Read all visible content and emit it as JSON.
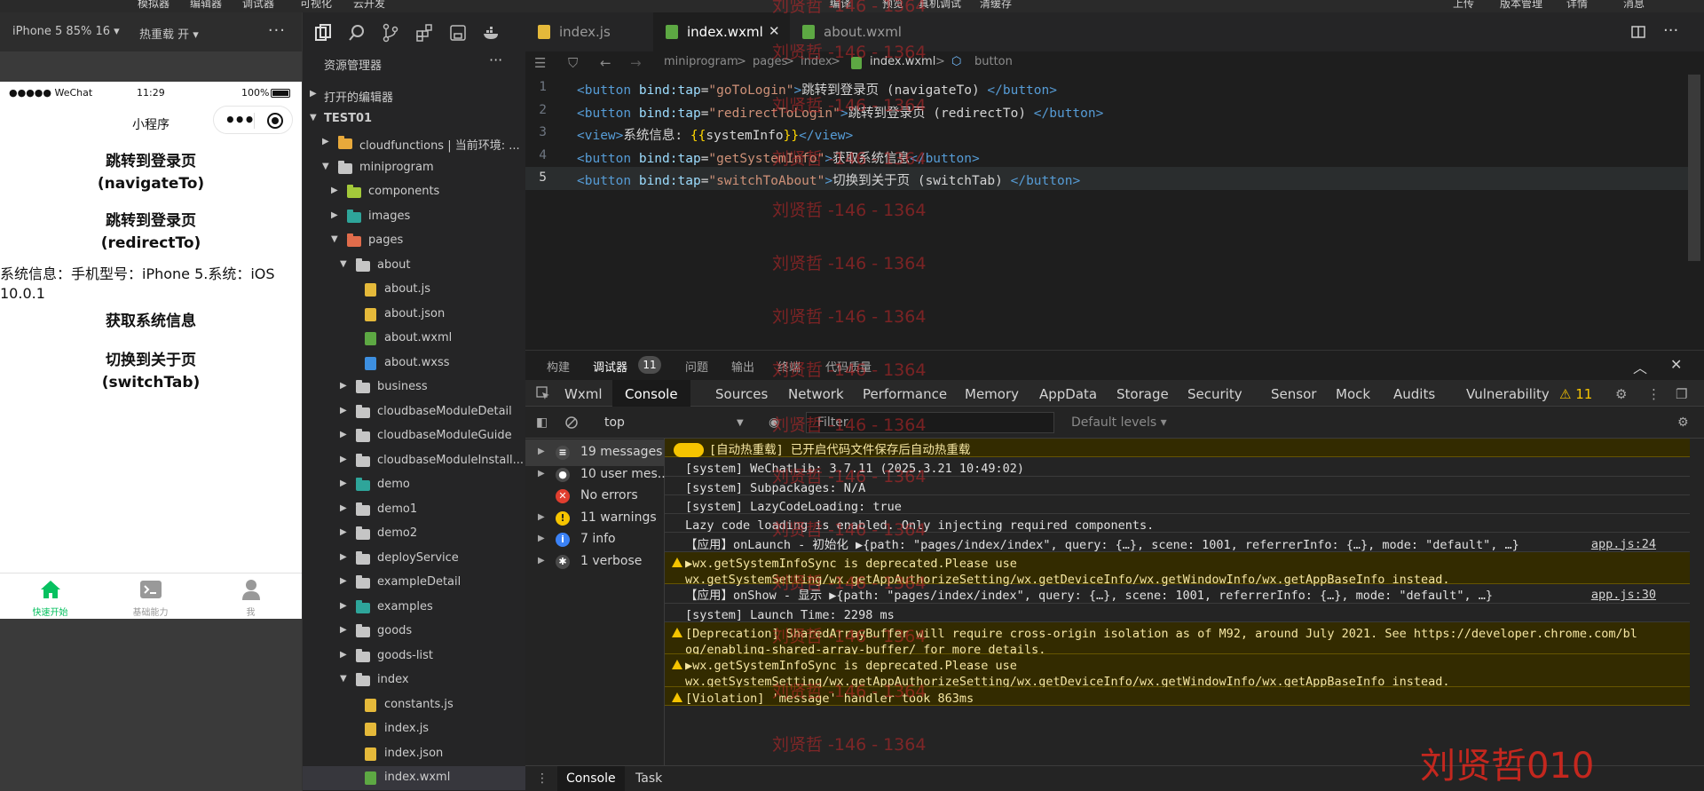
{
  "menubar": {
    "items": [
      "模拟器",
      "编辑器",
      "调试器",
      "可视化",
      "云开发",
      "编译",
      "预览",
      "真机调试",
      "清缓存",
      "上传",
      "版本管理",
      "详情",
      "消息"
    ]
  },
  "simulator": {
    "device_label": "iPhone 5 85% 16 ▾",
    "hot_reload_label": "热重载 开 ▾",
    "status_carrier": "●●●●● WeChat",
    "status_time": "11:29",
    "status_battery": "100%",
    "nav_title": "小程序",
    "buttons": [
      "跳转到登录页\n(navigateTo)",
      "跳转到登录页\n(redirectTo)",
      "获取系统信息",
      "切换到关于页\n(switchTab)"
    ],
    "system_info": "系统信息：手机型号：iPhone 5.系统：iOS 10.0.1",
    "tabs": [
      {
        "label": "快速开始",
        "icon": "home-icon",
        "color": "#07c160"
      },
      {
        "label": "基础能力",
        "icon": "terminal-icon",
        "color": "#999999"
      },
      {
        "label": "我",
        "icon": "user-icon",
        "color": "#999999"
      }
    ]
  },
  "explorer": {
    "title": "资源管理器",
    "sections": {
      "open_editors": "打开的编辑器",
      "project": "TEST01"
    },
    "tree": [
      {
        "label": "cloudfunctions | 当前环境: ...",
        "depth": 1,
        "type": "folder",
        "icon_color": "#e8a93b",
        "expanded": false
      },
      {
        "label": "miniprogram",
        "depth": 1,
        "type": "folder",
        "icon_color": "#c5c5c5",
        "expanded": true
      },
      {
        "label": "components",
        "depth": 2,
        "type": "folder",
        "icon_color": "#a3c93a",
        "expanded": false
      },
      {
        "label": "images",
        "depth": 2,
        "type": "folder",
        "icon_color": "#2ea59a",
        "expanded": false
      },
      {
        "label": "pages",
        "depth": 2,
        "type": "folder",
        "icon_color": "#e06c4b",
        "expanded": true
      },
      {
        "label": "about",
        "depth": 3,
        "type": "folder",
        "icon_color": "#c5c5c5",
        "expanded": true
      },
      {
        "label": "about.js",
        "depth": 4,
        "type": "file",
        "icon_color": "#e5b93a"
      },
      {
        "label": "about.json",
        "depth": 4,
        "type": "file",
        "icon_color": "#e5b93a"
      },
      {
        "label": "about.wxml",
        "depth": 4,
        "type": "file",
        "icon_color": "#5da843"
      },
      {
        "label": "about.wxss",
        "depth": 4,
        "type": "file",
        "icon_color": "#3d8fe0"
      },
      {
        "label": "business",
        "depth": 3,
        "type": "folder",
        "icon_color": "#c5c5c5",
        "expanded": false
      },
      {
        "label": "cloudbaseModuleDetail",
        "depth": 3,
        "type": "folder",
        "icon_color": "#c5c5c5",
        "expanded": false
      },
      {
        "label": "cloudbaseModuleGuide",
        "depth": 3,
        "type": "folder",
        "icon_color": "#c5c5c5",
        "expanded": false
      },
      {
        "label": "cloudbaseModuleInstall...",
        "depth": 3,
        "type": "folder",
        "icon_color": "#c5c5c5",
        "expanded": false
      },
      {
        "label": "demo",
        "depth": 3,
        "type": "folder",
        "icon_color": "#2ea59a",
        "expanded": false
      },
      {
        "label": "demo1",
        "depth": 3,
        "type": "folder",
        "icon_color": "#c5c5c5",
        "expanded": false
      },
      {
        "label": "demo2",
        "depth": 3,
        "type": "folder",
        "icon_color": "#c5c5c5",
        "expanded": false
      },
      {
        "label": "deployService",
        "depth": 3,
        "type": "folder",
        "icon_color": "#c5c5c5",
        "expanded": false
      },
      {
        "label": "exampleDetail",
        "depth": 3,
        "type": "folder",
        "icon_color": "#c5c5c5",
        "expanded": false
      },
      {
        "label": "examples",
        "depth": 3,
        "type": "folder",
        "icon_color": "#2ea59a",
        "expanded": false
      },
      {
        "label": "goods",
        "depth": 3,
        "type": "folder",
        "icon_color": "#c5c5c5",
        "expanded": false
      },
      {
        "label": "goods-list",
        "depth": 3,
        "type": "folder",
        "icon_color": "#c5c5c5",
        "expanded": false
      },
      {
        "label": "index",
        "depth": 3,
        "type": "folder",
        "icon_color": "#c5c5c5",
        "expanded": true
      },
      {
        "label": "constants.js",
        "depth": 4,
        "type": "file",
        "icon_color": "#e5b93a"
      },
      {
        "label": "index.js",
        "depth": 4,
        "type": "file",
        "icon_color": "#e5b93a"
      },
      {
        "label": "index.json",
        "depth": 4,
        "type": "file",
        "icon_color": "#e5b93a"
      },
      {
        "label": "index.wxml",
        "depth": 4,
        "type": "file",
        "icon_color": "#5da843",
        "selected": true
      }
    ]
  },
  "editor": {
    "tabs": [
      {
        "label": "index.js",
        "icon_color": "#e5b93a",
        "active": false
      },
      {
        "label": "index.wxml",
        "icon_color": "#5da843",
        "active": true,
        "close": "✕"
      },
      {
        "label": "about.wxml",
        "icon_color": "#5da843",
        "active": false
      }
    ],
    "breadcrumb": [
      "miniprogram",
      ">",
      "pages",
      ">",
      "index",
      ">",
      "index.wxml",
      ">",
      "button"
    ],
    "lines": [
      {
        "n": "1",
        "parts": [
          [
            "tg",
            "<button "
          ],
          [
            "at",
            "bind:tap"
          ],
          [
            "tx",
            "="
          ],
          [
            "st",
            "\"goToLogin\""
          ],
          [
            "tg",
            ">"
          ],
          [
            "tx",
            "跳转到登录页 (navigateTo) "
          ],
          [
            "tg",
            "</button>"
          ]
        ]
      },
      {
        "n": "2",
        "parts": [
          [
            "tg",
            "<button "
          ],
          [
            "at",
            "bind:tap"
          ],
          [
            "tx",
            "="
          ],
          [
            "st",
            "\"redirectToLogin\""
          ],
          [
            "tg",
            ">"
          ],
          [
            "tx",
            "跳转到登录页 (redirectTo) "
          ],
          [
            "tg",
            "</button>"
          ]
        ]
      },
      {
        "n": "3",
        "parts": [
          [
            "tg",
            "<view>"
          ],
          [
            "tx",
            "系统信息: "
          ],
          [
            "br",
            "{{"
          ],
          [
            "tx",
            "systemInfo"
          ],
          [
            "br",
            "}}"
          ],
          [
            "tg",
            "</view>"
          ]
        ]
      },
      {
        "n": "4",
        "parts": [
          [
            "tg",
            "<button "
          ],
          [
            "at",
            "bind:tap"
          ],
          [
            "tx",
            "="
          ],
          [
            "st",
            "\"getSystemInfo\""
          ],
          [
            "tg",
            ">"
          ],
          [
            "tx",
            "获取系统信息"
          ],
          [
            "tg",
            "</button>"
          ]
        ]
      },
      {
        "n": "5",
        "parts": [
          [
            "tg",
            "<button "
          ],
          [
            "at",
            "bind:tap"
          ],
          [
            "tx",
            "="
          ],
          [
            "st",
            "\"switchToAbout\""
          ],
          [
            "tg",
            ">"
          ],
          [
            "tx",
            "切换到关于页 (switchTab) "
          ],
          [
            "tg",
            "</button>"
          ]
        ],
        "current": true
      }
    ]
  },
  "debugger": {
    "tabs": [
      "构建",
      "调试器",
      "问题",
      "输出",
      "终端",
      "代码质量"
    ],
    "badge": "11",
    "devtools_tabs": [
      "Wxml",
      "Console",
      "Sources",
      "Network",
      "Performance",
      "Memory",
      "AppData",
      "Storage",
      "Security",
      "Sensor",
      "Mock",
      "Audits",
      "Vulnerability"
    ],
    "warning_count": "⚠ 11",
    "context": "top",
    "filter_placeholder": "Filter",
    "levels": "Default levels ▾",
    "sidebar": [
      {
        "label": "19 messages",
        "icon": "list-icon",
        "arrow": "▶"
      },
      {
        "label": "10 user mes...",
        "icon": "user-icon",
        "arrow": "▶"
      },
      {
        "label": "No errors",
        "icon": "error-icon",
        "arrow": ""
      },
      {
        "label": "11 warnings",
        "icon": "warning-icon",
        "arrow": "▶"
      },
      {
        "label": "7 info",
        "icon": "info-icon",
        "arrow": "▶"
      },
      {
        "label": "1 verbose",
        "icon": "bug-icon",
        "arrow": "▶"
      }
    ],
    "messages": [
      {
        "type": "warn",
        "text": "[自动热重载] 已开启代码文件保存后自动热重载",
        "pill": true
      },
      {
        "type": "log",
        "text": "[system] WeChatLib: 3.7.11 (2025.3.21 10:49:02)"
      },
      {
        "type": "log",
        "text": "[system] Subpackages: N/A"
      },
      {
        "type": "log",
        "text": "[system] LazyCodeLoading: true"
      },
      {
        "type": "log",
        "text": "Lazy code loading is enabled. Only injecting required components."
      },
      {
        "type": "log",
        "text": "【应用】onLaunch - 初始化 ▶{path: \"pages/index/index\", query: {…}, scene: 1001, referrerInfo: {…}, mode: \"default\", …}",
        "src": "app.js:24"
      },
      {
        "type": "warn",
        "text": "▶wx.getSystemInfoSync is deprecated.Please use\nwx.getSystemSetting/wx.getAppAuthorizeSetting/wx.getDeviceInfo/wx.getWindowInfo/wx.getAppBaseInfo instead."
      },
      {
        "type": "log",
        "text": "【应用】onShow - 显示 ▶{path: \"pages/index/index\", query: {…}, scene: 1001, referrerInfo: {…}, mode: \"default\", …}",
        "src": "app.js:30"
      },
      {
        "type": "log",
        "text": "[system] Launch Time: 2298 ms"
      },
      {
        "type": "warn",
        "text": "[Deprecation] SharedArrayBuffer will require cross-origin isolation as of M92, around July 2021. See https://developer.chrome.com/bl\nog/enabling-shared-array-buffer/ for more details."
      },
      {
        "type": "warn",
        "text": "▶wx.getSystemInfoSync is deprecated.Please use\nwx.getSystemSetting/wx.getAppAuthorizeSetting/wx.getDeviceInfo/wx.getWindowInfo/wx.getAppBaseInfo instead."
      },
      {
        "type": "warn",
        "text": "[Violation] 'message' handler took 863ms"
      }
    ],
    "bottom_tabs": [
      "Console",
      "Task"
    ]
  },
  "watermark": {
    "text": "刘贤哲 -146 - 1364",
    "big": "刘贤哲010"
  }
}
